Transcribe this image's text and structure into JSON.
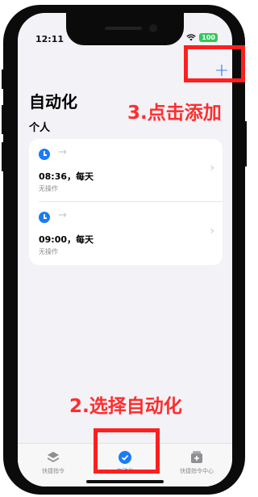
{
  "status_bar": {
    "time": "12:11",
    "battery": "100",
    "wifi_icon": "wifi-icon"
  },
  "header": {
    "title": "自动化",
    "add_label": "+"
  },
  "section": {
    "label": "个人"
  },
  "automations": [
    {
      "time_label": "08:36，每天",
      "subtitle": "无操作"
    },
    {
      "time_label": "09:00，每天",
      "subtitle": "无操作"
    }
  ],
  "tabs": [
    {
      "label": "快捷指令",
      "icon": "layers-icon",
      "active": false
    },
    {
      "label": "自动化",
      "icon": "check-clock-icon",
      "active": true
    },
    {
      "label": "快捷指令中心",
      "icon": "gallery-icon",
      "active": false
    }
  ],
  "annotations": {
    "add_hint": "3.点击添加",
    "select_hint": "2.选择自动化"
  },
  "colors": {
    "accent": "#1a7cf5",
    "annotation_red": "#ff1f1f",
    "background": "#f2f2f7"
  }
}
